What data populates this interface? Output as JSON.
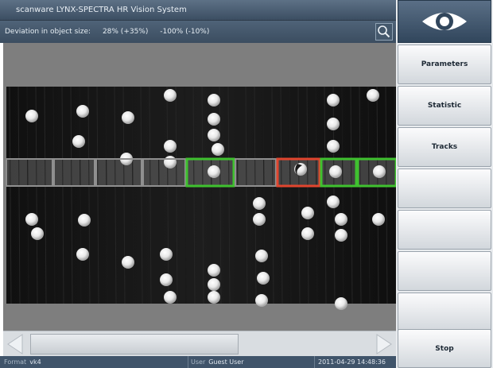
{
  "window": {
    "title": "scanware LYNX-SPECTRA HR Vision System"
  },
  "info_bar": {
    "label": "Deviation in object size:",
    "value_1": "28% (+35%)",
    "value_2": "-100% (-10%)"
  },
  "toolbar": {
    "search_icon": "magnifier-icon"
  },
  "side_panel": {
    "eye_icon": "eye-icon",
    "buttons": [
      "Parameters",
      "Statistic",
      "Tracks",
      "",
      "",
      "",
      "",
      "Stop"
    ]
  },
  "status_bar": {
    "format_label": "Format",
    "format_value": "vk4",
    "user_label": "User",
    "user_value": "Guest User",
    "datetime": "2011-04-29 14:48:36"
  },
  "inspection": {
    "slots": [
      {
        "status": "empty"
      },
      {
        "status": "empty"
      },
      {
        "status": "empty"
      },
      {
        "status": "empty"
      },
      {
        "status": "ok"
      },
      {
        "status": "empty"
      },
      {
        "status": "defect"
      },
      {
        "status": "ok"
      },
      {
        "status": "ok"
      }
    ]
  },
  "colors": {
    "ok": "#3fc12f",
    "defect": "#e1452e",
    "empty": "#8f8f8f"
  }
}
